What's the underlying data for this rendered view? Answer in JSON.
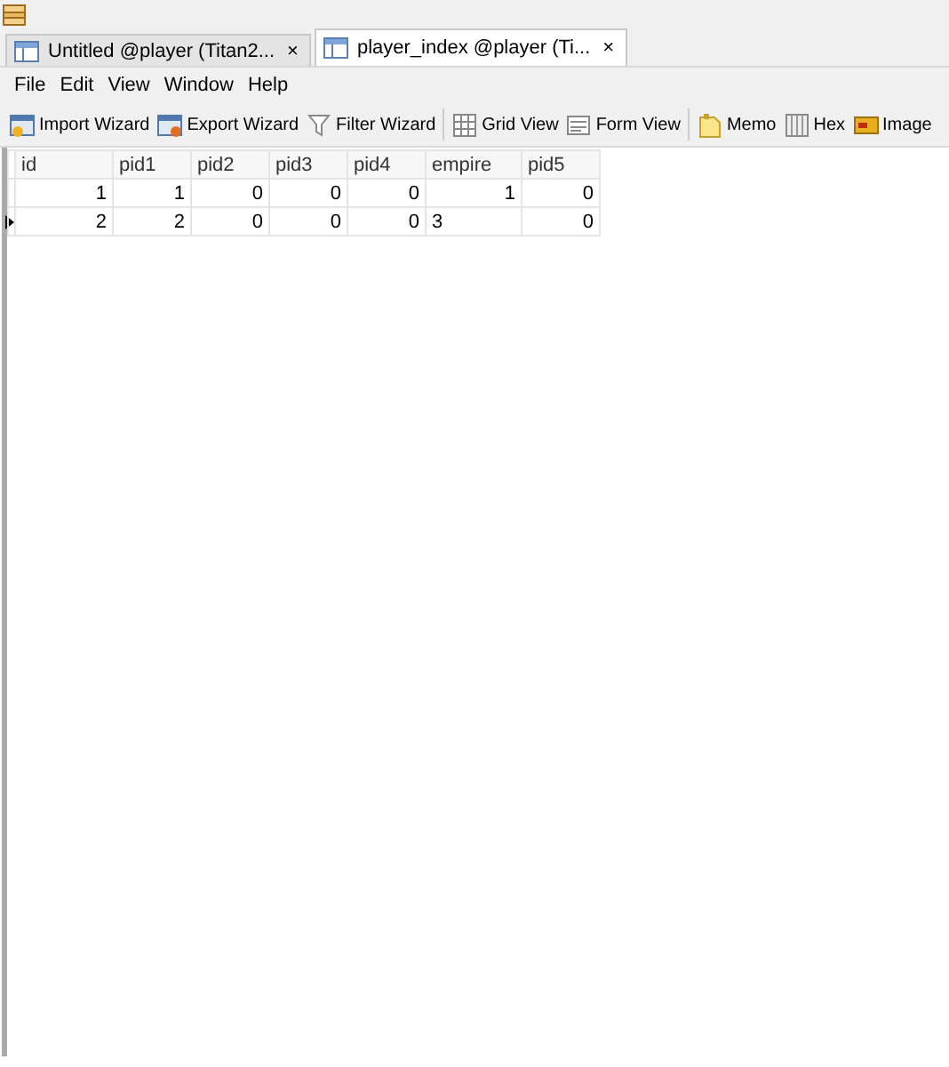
{
  "tabs": [
    {
      "label": "Untitled @player (Titan2...",
      "close": "×",
      "selected": false
    },
    {
      "label": "player_index @player (Ti...",
      "close": "×",
      "selected": true
    }
  ],
  "menu": [
    "File",
    "Edit",
    "View",
    "Window",
    "Help"
  ],
  "toolbar": [
    [
      "Import Wizard",
      "Export Wizard",
      "Filter Wizard"
    ],
    [
      "Grid View",
      "Form View"
    ],
    [
      "Memo",
      "Hex",
      "Image"
    ]
  ],
  "table": {
    "columns": [
      "id",
      "pid1",
      "pid2",
      "pid3",
      "pid4",
      "empire",
      "pid5"
    ],
    "rows": [
      {
        "current": false,
        "cells": [
          {
            "text": "1",
            "editing": false
          },
          {
            "text": "1",
            "editing": false
          },
          {
            "text": "0",
            "editing": false
          },
          {
            "text": "0",
            "editing": false
          },
          {
            "text": "0",
            "editing": false
          },
          {
            "text": "1",
            "editing": false
          },
          {
            "text": "0",
            "editing": false
          }
        ]
      },
      {
        "current": true,
        "cells": [
          {
            "text": "2",
            "editing": false
          },
          {
            "text": "2",
            "editing": false
          },
          {
            "text": "0",
            "editing": false
          },
          {
            "text": "0",
            "editing": false
          },
          {
            "text": "0",
            "editing": false
          },
          {
            "text": "3",
            "editing": true
          },
          {
            "text": "0",
            "editing": false
          }
        ]
      }
    ]
  }
}
